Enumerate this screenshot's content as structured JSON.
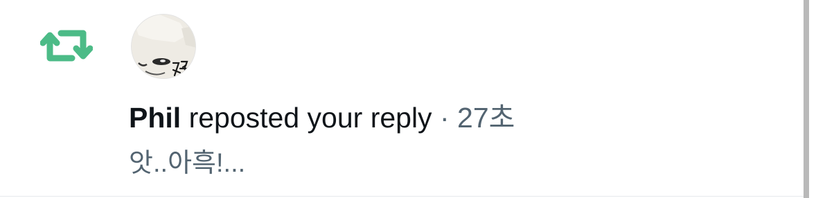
{
  "notification": {
    "type_icon": "repost-icon",
    "avatar_icon": "user-avatar",
    "actor_name": "Phil",
    "action_text": "reposted your reply",
    "separator": "·",
    "timestamp": "27초",
    "reply_text": "앗..아흑!..."
  },
  "colors": {
    "repost_accent": "#4cbb87",
    "primary_text": "#0f1419",
    "secondary_text": "#536471"
  }
}
